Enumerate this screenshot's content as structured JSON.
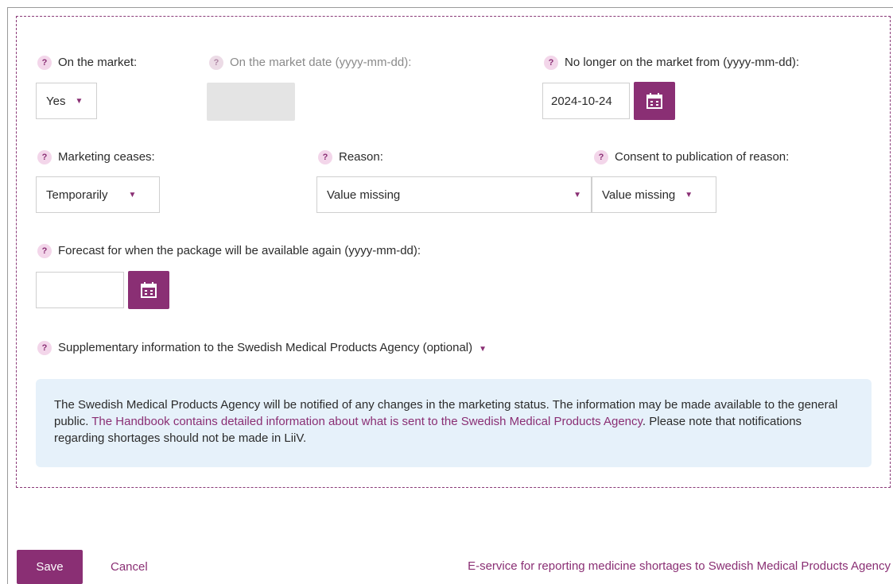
{
  "fields": {
    "on_market": {
      "label": "On the market:",
      "value": "Yes"
    },
    "on_market_date": {
      "label": "On the market date (yyyy-mm-dd):"
    },
    "no_longer_on_market": {
      "label": "No longer on the market from (yyyy-mm-dd):",
      "value": "2024-10-24"
    },
    "marketing_ceases": {
      "label": "Marketing ceases:",
      "value": "Temporarily"
    },
    "reason": {
      "label": "Reason:",
      "value": "Value missing"
    },
    "consent": {
      "label": "Consent to publication of reason:",
      "value": "Value missing"
    },
    "forecast": {
      "label": "Forecast for when the package will be available again (yyyy-mm-dd):",
      "value": ""
    },
    "supplementary": {
      "label": "Supplementary information to the Swedish Medical Products Agency (optional)"
    }
  },
  "help_icon_glyph": "?",
  "info": {
    "text_before": "The Swedish Medical Products Agency will be notified of any changes in the marketing status. The information may be made available to the general public.",
    "link": "The Handbook contains detailed information about what is sent to the Swedish Medical Products Agency",
    "text_after": ". Please note that notifications regarding shortages should not be made in LiiV."
  },
  "footer": {
    "save": "Save",
    "cancel": "Cancel",
    "eservice": "E-service for reporting medicine shortages to Swedish Medical Products Agency"
  },
  "colors": {
    "accent": "#8a2f74",
    "info_bg": "#e6f1fa",
    "help_icon_bg": "#f3d6ea"
  }
}
